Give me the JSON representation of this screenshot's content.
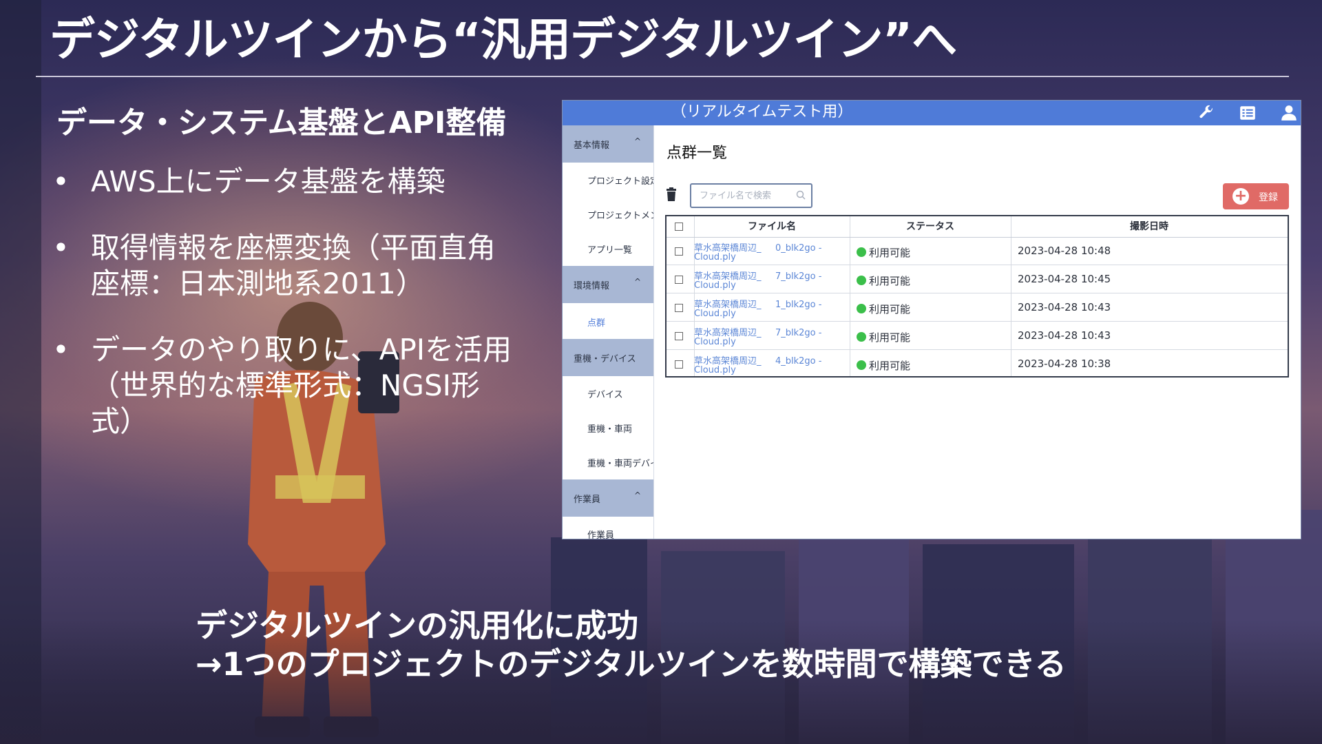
{
  "slide": {
    "title": "デジタルツインから“汎用デジタルツイン”へ",
    "subtitle": "データ・システム基盤とAPI整備",
    "bullets": [
      {
        "lines": [
          "AWS上にデータ基盤を構築"
        ]
      },
      {
        "lines": [
          "取得情報を座標変換（平面直角",
          "座標：日本測地系2011）"
        ]
      },
      {
        "lines": [
          "データのやり取りに、APIを活用",
          "（世界的な標準形式：NGSI形",
          "式）"
        ]
      }
    ],
    "conclusion": [
      "デジタルツインの汎用化に成功",
      "→1つのプロジェクトのデジタルツインを数時間で構築できる"
    ],
    "bullet_char": "•"
  },
  "app": {
    "header_title": "（リアルタイムテスト用）",
    "header_icons": [
      "wrench-icon",
      "list-icon",
      "user-icon"
    ],
    "colors": {
      "header": "#4f7bd8",
      "group": "#a8b7d4",
      "register": "#e06a66",
      "link": "#5b86d6",
      "ok": "#3bbf4a"
    },
    "sidebar": {
      "groups": [
        {
          "label": "基本情報",
          "chevron": "^",
          "items": [
            "プロジェクト設定",
            "プロジェクトメンバー",
            "アプリ一覧"
          ]
        },
        {
          "label": "環境情報",
          "chevron": "^",
          "items": [
            "点群"
          ]
        },
        {
          "label": "重機・デバイス",
          "chevron": "^",
          "items": [
            "デバイス",
            "重機・車両",
            "重機・車両デバイス"
          ]
        },
        {
          "label": "作業員",
          "chevron": "^",
          "items": [
            "作業員"
          ]
        }
      ]
    },
    "main": {
      "title": "点群一覧",
      "search_placeholder": "ファイル名で検索",
      "register_label": "登録",
      "table": {
        "headers": [
          "ファイル名",
          "ステータス",
          "撮影日時"
        ],
        "rows": [
          {
            "file_line1": "草水高架橋周辺_",
            "file_suffix": "0_blk2go -",
            "file_line2": "Cloud.ply",
            "status": "利用可能",
            "date": "2023-04-28 10:48"
          },
          {
            "file_line1": "草水高架橋周辺_",
            "file_suffix": "7_blk2go -",
            "file_line2": "Cloud.ply",
            "status": "利用可能",
            "date": "2023-04-28 10:45"
          },
          {
            "file_line1": "草水高架橋周辺_",
            "file_suffix": "1_blk2go -",
            "file_line2": "Cloud.ply",
            "status": "利用可能",
            "date": "2023-04-28 10:43"
          },
          {
            "file_line1": "草水高架橋周辺_",
            "file_suffix": "7_blk2go -",
            "file_line2": "Cloud.ply",
            "status": "利用可能",
            "date": "2023-04-28 10:43"
          },
          {
            "file_line1": "草水高架橋周辺_",
            "file_suffix": "4_blk2go -",
            "file_line2": "Cloud.ply",
            "status": "利用可能",
            "date": "2023-04-28 10:38"
          }
        ]
      }
    }
  }
}
